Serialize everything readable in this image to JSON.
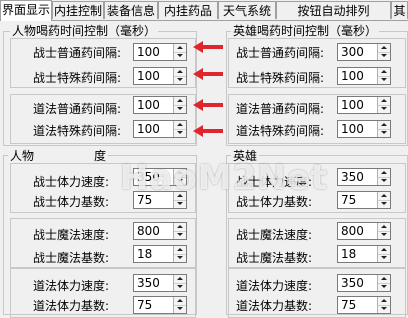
{
  "tabs": [
    "界面显示",
    "内挂控制",
    "装备信息",
    "内挂药品",
    "天气系统",
    "按钮自动排列",
    "其"
  ],
  "player_group": {
    "title": "人物喝药时间控制（毫秒）",
    "warrior_normal_label": "战士普通药间隔:",
    "warrior_normal_value": "100",
    "warrior_special_label": "战士特殊药间隔:",
    "warrior_special_value": "100",
    "taoist_normal_label": "道法普通药间隔:",
    "taoist_normal_value": "100",
    "taoist_special_label": "道法特殊药间隔:",
    "taoist_special_value": "100"
  },
  "hero_group": {
    "title": "英雄喝药时间控制（毫秒）",
    "warrior_normal_label": "战士普通药间隔:",
    "warrior_normal_value": "300",
    "warrior_special_label": "战士特殊药间隔:",
    "warrior_special_value": "100",
    "taoist_normal_label": "道法普通药间隔:",
    "taoist_normal_value": "100",
    "taoist_special_label": "道法特殊药间隔:",
    "taoist_special_value": "100"
  },
  "player_speed_group": {
    "title": "人物",
    "title_tail": "度",
    "warrior_hp_speed_label": "战士体力速度:",
    "warrior_hp_speed_value": "350",
    "warrior_hp_base_label": "战士体力基数:",
    "warrior_hp_base_value": "75",
    "warrior_mp_speed_label": "战士魔法速度:",
    "warrior_mp_speed_value": "800",
    "warrior_mp_base_label": "战士魔法基数:",
    "warrior_mp_base_value": "18",
    "taoist_hp_speed_label": "道法体力速度:",
    "taoist_hp_speed_value": "350",
    "taoist_hp_base_label": "道法体力基数:",
    "taoist_hp_base_value": "75"
  },
  "hero_speed_group": {
    "title": "英雄",
    "warrior_hp_speed_label": "战士体力速度:",
    "warrior_hp_speed_value": "350",
    "warrior_hp_base_label": "战士体力基数:",
    "warrior_hp_base_value": "75",
    "warrior_mp_speed_label": "战士魔法速度:",
    "warrior_mp_speed_value": "800",
    "warrior_mp_base_label": "战士魔法基数:",
    "warrior_mp_base_value": "18",
    "taoist_hp_speed_label": "道法体力速度:",
    "taoist_hp_speed_value": "350",
    "taoist_hp_base_label": "道法体力基数:",
    "taoist_hp_base_value": "75"
  },
  "watermark": "HaoM2Net",
  "colors": {
    "arrow": "#e0262c",
    "group_border": "#c8c8c8",
    "background": "#f0f0f0"
  },
  "icons": {
    "annotation": "red-arrow-icon",
    "spinner": "up-down-spin-icon"
  }
}
